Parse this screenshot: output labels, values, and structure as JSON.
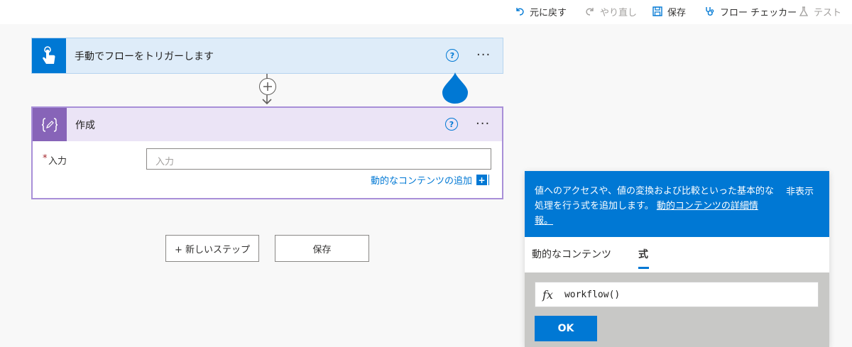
{
  "toolbar": {
    "undo": "元に戻す",
    "redo": "やり直し",
    "save": "保存",
    "flow_checker": "フロー チェッカー",
    "test": "テスト"
  },
  "trigger": {
    "title": "手動でフローをトリガーします",
    "help": "?",
    "more": "···",
    "color": "#0078d4"
  },
  "compose": {
    "title": "作成",
    "help": "?",
    "more": "···",
    "required_mark": "*",
    "input_label": "入力",
    "input_placeholder": "入力",
    "add_dynamic": "動的なコンテンツの追加",
    "add_icon_glyph": "+",
    "color": "#8764b8"
  },
  "buttons": {
    "new_step": "+ 新しいステップ",
    "save": "保存"
  },
  "panel": {
    "description": "値へのアクセスや、値の変換および比較といった基本的な処理を行う式を追加します。",
    "learn_more": "動的コンテンツの詳細情報。",
    "hide": "非表示",
    "tab_dynamic": "動的なコンテンツ",
    "tab_expression": "式",
    "fx": "fx",
    "expression": "workflow()",
    "ok": "OK"
  },
  "colors": {
    "accent": "#0078d4",
    "compose": "#8764b8"
  }
}
